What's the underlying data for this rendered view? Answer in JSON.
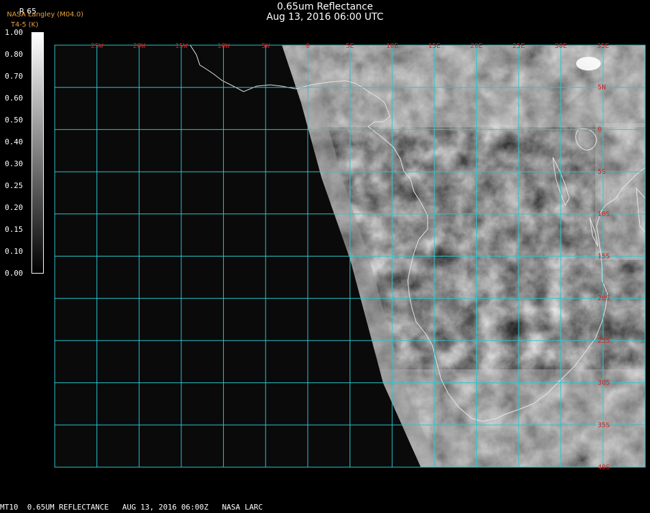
{
  "title": "0.65um Reflectance",
  "subtitle": "Aug 13, 2016 06:00 UTC",
  "logo_line1": "NASA Langley (M04.0)",
  "logo_line2": "T4-5 (K)",
  "units_label": "R 65",
  "colorbar_ticks": [
    "1.00",
    "0.80",
    "0.70",
    "0.60",
    "0.50",
    "0.40",
    "0.30",
    "0.25",
    "0.20",
    "0.15",
    "0.10",
    "0.00"
  ],
  "lon_labels": [
    "25W",
    "20W",
    "15W",
    "10W",
    "5W",
    "0",
    "5E",
    "10E",
    "15E",
    "20E",
    "25E",
    "30E",
    "35E"
  ],
  "lat_labels": [
    "5N",
    "0",
    "5S",
    "10S",
    "15S",
    "20S",
    "25S",
    "30S",
    "35S",
    "40S"
  ],
  "footer": "MT10  0.65UM REFLECTANCE   AUG 13, 2016 06:00Z   NASA LARC",
  "colors": {
    "grid": "#28c8d0",
    "label": "#d02020",
    "background": "#000000",
    "ocean_dark": "#0a0a0a"
  }
}
